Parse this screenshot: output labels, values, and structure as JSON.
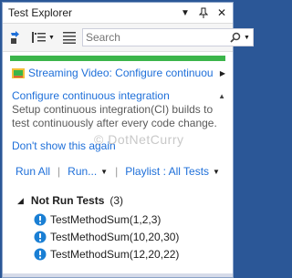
{
  "window": {
    "title": "Test Explorer"
  },
  "toolbar": {
    "search_placeholder": "Search"
  },
  "notice": {
    "video_link": "Streaming Video: Configure continuou",
    "title": "Configure continuous integration",
    "description_lines": [
      "Setup continuous integration(CI) builds to",
      "test continuously after every code change."
    ],
    "dont_show": "Don't show this again"
  },
  "watermark": "© DotNetCurry",
  "actions": {
    "run_all": "Run All",
    "run": "Run...",
    "playlist": "Playlist : All Tests"
  },
  "group": {
    "name": "Not Run Tests",
    "count": "(3)"
  },
  "tests": [
    {
      "name": "TestMethodSum(1,2,3)"
    },
    {
      "name": "TestMethodSum(10,20,30)"
    },
    {
      "name": "TestMethodSum(12,20,22)"
    }
  ],
  "colors": {
    "link": "#1e6fd9",
    "progress": "#3bb54a",
    "frame": "#2b5797",
    "status_icon": "#1a7fd4"
  }
}
